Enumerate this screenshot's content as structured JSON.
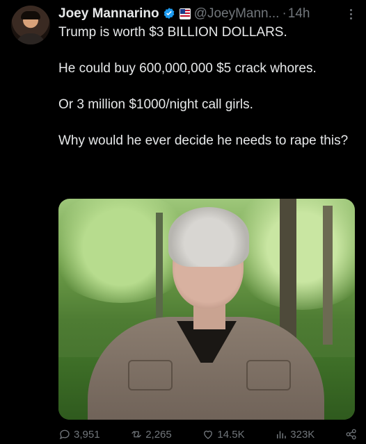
{
  "author": {
    "name": "Joey Mannarino",
    "handle": "@JoeyMann...",
    "separator": "·",
    "time": "14h"
  },
  "tweet": {
    "paragraphs": [
      "Trump is worth $3 BILLION DOLLARS.",
      "He could buy 600,000,000 $5 crack whores.",
      "Or 3 million $1000/night call girls.",
      "Why would he ever decide he needs to rape this?"
    ]
  },
  "actions": {
    "replies": "3,951",
    "reposts": "2,265",
    "likes": "14.5K",
    "views": "323K"
  },
  "colors": {
    "background": "#000000",
    "text": "#e7e9ea",
    "muted": "#71767b",
    "verified": "#1d9bf0"
  },
  "icons": [
    "verified-badge-icon",
    "flag-badge-icon",
    "more-icon",
    "reply-icon",
    "repost-icon",
    "like-icon",
    "views-icon",
    "share-icon"
  ]
}
